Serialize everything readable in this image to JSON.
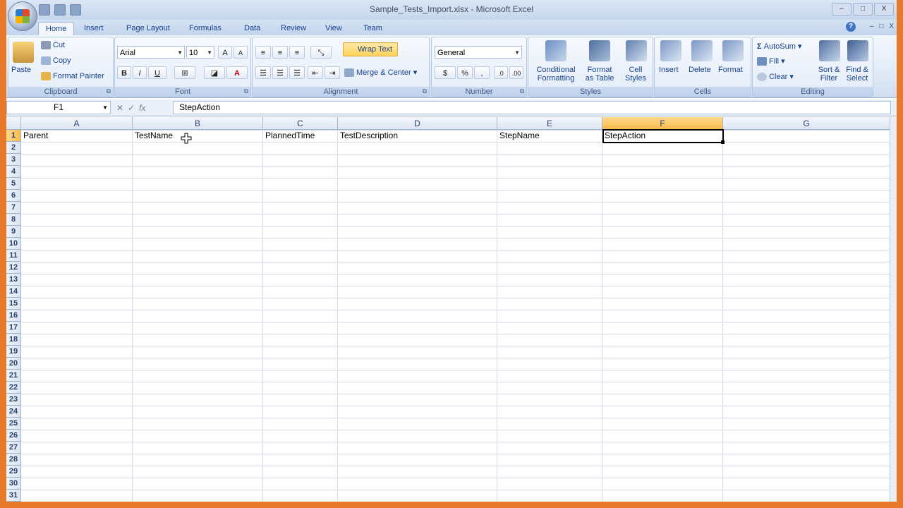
{
  "app": {
    "title": "Sample_Tests_Import.xlsx - Microsoft Excel",
    "window_controls": [
      "–",
      "□",
      "X"
    ],
    "mdi_controls": [
      "–",
      "□",
      "X"
    ]
  },
  "tabs": [
    {
      "label": "Home",
      "active": true
    },
    {
      "label": "Insert"
    },
    {
      "label": "Page Layout"
    },
    {
      "label": "Formulas"
    },
    {
      "label": "Data"
    },
    {
      "label": "Review"
    },
    {
      "label": "View"
    },
    {
      "label": "Team"
    }
  ],
  "ribbon": {
    "clipboard": {
      "label": "Clipboard",
      "paste": "Paste",
      "cut": "Cut",
      "copy": "Copy",
      "format_painter": "Format Painter"
    },
    "font": {
      "label": "Font",
      "font_name": "Arial",
      "font_size": "10",
      "bold": "B",
      "italic": "I",
      "underline": "U"
    },
    "alignment": {
      "label": "Alignment",
      "wrap_text": "Wrap Text",
      "merge_center": "Merge & Center"
    },
    "number": {
      "label": "Number",
      "format": "General",
      "currency": "$",
      "percent": "%",
      "comma": ","
    },
    "styles": {
      "label": "Styles",
      "conditional_1": "Conditional",
      "conditional_2": "Formatting",
      "format_table_1": "Format",
      "format_table_2": "as Table",
      "cell_styles_1": "Cell",
      "cell_styles_2": "Styles"
    },
    "cells": {
      "label": "Cells",
      "insert": "Insert",
      "delete": "Delete",
      "format": "Format"
    },
    "editing": {
      "label": "Editing",
      "autosum": "AutoSum",
      "fill": "Fill",
      "clear": "Clear",
      "sort_1": "Sort &",
      "sort_2": "Filter",
      "find_1": "Find &",
      "find_2": "Select"
    }
  },
  "formula_bar": {
    "name_box": "F1",
    "value": "StepAction"
  },
  "sheet": {
    "columns": [
      "A",
      "B",
      "C",
      "D",
      "E",
      "F",
      "G"
    ],
    "selected_column": "F",
    "selected_row": 1,
    "row_count": 31,
    "header_cells": [
      "Parent",
      "TestName",
      "PlannedTime",
      "TestDescription",
      "StepName",
      "StepAction",
      ""
    ]
  },
  "colors": {
    "accent": "#15428b",
    "selection": "#f9b94a",
    "frame": "#e8792a"
  }
}
